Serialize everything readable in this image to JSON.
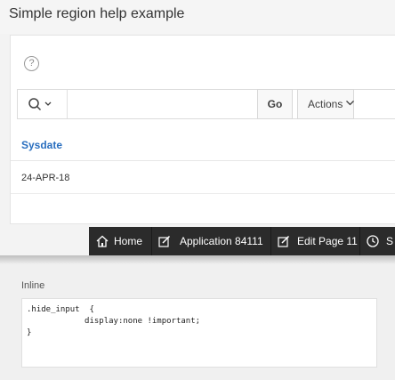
{
  "page": {
    "title": "Simple region help example"
  },
  "region": {
    "help_icon": "help-icon",
    "toolbar": {
      "search_icon": "search-icon",
      "search_value": "",
      "go_label": "Go",
      "actions_label": "Actions"
    },
    "report": {
      "columns": [
        "Sysdate"
      ],
      "rows": [
        [
          "24-APR-18"
        ]
      ]
    }
  },
  "dev_toolbar": {
    "items": [
      {
        "icon": "home-icon",
        "label": "Home"
      },
      {
        "icon": "edit-icon",
        "label": "Application 84111"
      },
      {
        "icon": "edit-icon",
        "label": "Edit Page 11"
      },
      {
        "icon": "clock-icon",
        "label": "S"
      }
    ]
  },
  "inline_panel": {
    "label": "Inline",
    "code_lines": [
      ".hide_input  {",
      "            display:none !important;",
      "}"
    ]
  },
  "colors": {
    "link_blue": "#2a6fbf",
    "dev_toolbar_bg": "#2b2b2b"
  }
}
